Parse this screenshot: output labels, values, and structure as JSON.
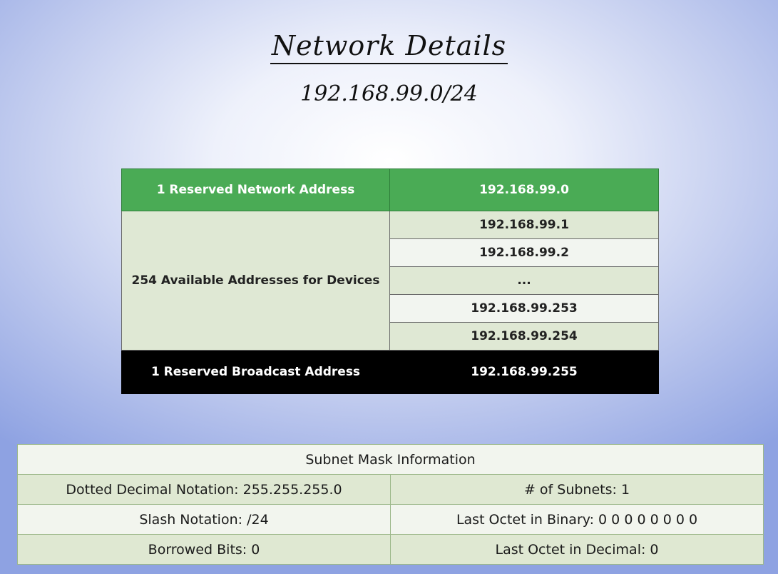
{
  "heading": {
    "title": "Network Details",
    "network": "192.168.99.0/24"
  },
  "address_table": {
    "network_row": {
      "label": "1 Reserved Network Address",
      "value": "192.168.99.0"
    },
    "devices_label": "254 Available Addresses for Devices",
    "device_addresses": [
      "192.168.99.1",
      "192.168.99.2",
      "...",
      "192.168.99.253",
      "192.168.99.254"
    ],
    "broadcast_row": {
      "label": "1 Reserved Broadcast Address",
      "value": "192.168.99.255"
    }
  },
  "subnet_info": {
    "title": "Subnet Mask Information",
    "dotted_decimal": "Dotted Decimal Notation: 255.255.255.0",
    "subnets": "# of Subnets: 1",
    "slash": "Slash Notation: /24",
    "last_octet_binary": "Last Octet in Binary: 0 0 0 0 0 0 0 0",
    "borrowed_bits": "Borrowed Bits: 0",
    "last_octet_decimal": "Last Octet in Decimal: 0"
  }
}
